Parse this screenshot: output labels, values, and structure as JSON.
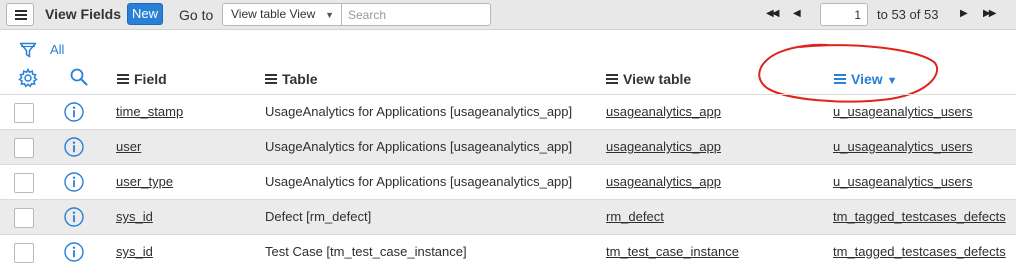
{
  "header": {
    "title": "View Fields",
    "new_label": "New",
    "goto_label": "Go to",
    "goto_selected": "View table View",
    "search_placeholder": "Search",
    "pager": {
      "first": "◀◀",
      "prev": "◀",
      "page_value": "1",
      "range_text": "to 53 of 53",
      "next": "▶",
      "last": "▶▶"
    }
  },
  "filter": {
    "all_label": "All"
  },
  "columns": {
    "field": "Field",
    "table": "Table",
    "view_table": "View table",
    "view": "View",
    "sorted_column": "view",
    "sort_direction": "descending"
  },
  "rows": [
    {
      "field": "time_stamp",
      "table": "UsageAnalytics for Applications [usageanalytics_app]",
      "view_table": "usageanalytics_app",
      "view": "u_usageanalytics_users"
    },
    {
      "field": "user",
      "table": "UsageAnalytics for Applications [usageanalytics_app]",
      "view_table": "usageanalytics_app",
      "view": "u_usageanalytics_users"
    },
    {
      "field": "user_type",
      "table": "UsageAnalytics for Applications [usageanalytics_app]",
      "view_table": "usageanalytics_app",
      "view": "u_usageanalytics_users"
    },
    {
      "field": "sys_id",
      "table": "Defect [rm_defect]",
      "view_table": "rm_defect",
      "view": "tm_tagged_testcases_defects"
    },
    {
      "field": "sys_id",
      "table": "Test Case [tm_test_case_instance]",
      "view_table": "tm_test_case_instance",
      "view": "tm_tagged_testcases_defects"
    }
  ],
  "colors": {
    "accent": "#2a7fd7",
    "header_bg": "#e8e8e8",
    "row_alt_bg": "#ebebeb",
    "annotation": "#e0231c"
  },
  "icons": [
    "menu-icon",
    "filter-icon",
    "gear-icon",
    "search-icon",
    "info-icon",
    "sort-down-icon"
  ]
}
